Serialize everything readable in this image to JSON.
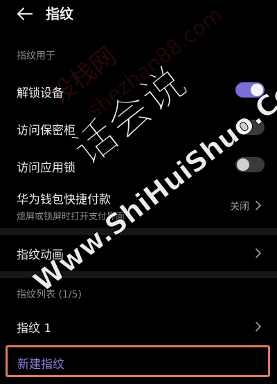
{
  "header": {
    "title": "指纹",
    "back_icon": "arrow-left-icon"
  },
  "section_use": {
    "header": "指纹用于"
  },
  "settings": {
    "unlock_device": {
      "label": "解锁设备",
      "toggle": "on"
    },
    "safe": {
      "label": "访问保密柜",
      "toggle": "off"
    },
    "app_lock": {
      "label": "访问应用锁",
      "toggle": "off"
    },
    "wallet": {
      "label": "华为钱包快捷付款",
      "sublabel": "熄屏或锁屏时打开支付界面",
      "status": "关闭"
    }
  },
  "animation": {
    "label": "指纹动画"
  },
  "fingerprint_list": {
    "header": "指纹列表 (1/5)",
    "items": [
      {
        "label": "指纹 1"
      }
    ],
    "new_label": "新建指纹"
  },
  "watermarks": {
    "main": "话会说",
    "latin": "Www.ShiHuiShuo.Com",
    "faint_cn": "设栈网",
    "faint_latin": "shezhan88.com"
  },
  "colors": {
    "background": "#000000",
    "accent": "#7b6fd6",
    "highlight_border": "#e07a5f",
    "new_link": "#8b80e6"
  }
}
